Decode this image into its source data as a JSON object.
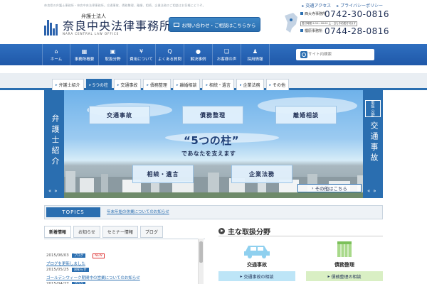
{
  "header": {
    "tagline": "奈良県の弁護士事務所・奈良中央法律事務所。交通事故、債務整理、離婚、相続、企業法務のご相談はお気軽にどうぞ。",
    "links": [
      "交通アクセス",
      "プライバシーポリシー"
    ],
    "logo": {
      "sub": "弁護士法人",
      "main": "奈良中央法律事務所",
      "en": "NARA CENTRAL LAW OFFICE"
    },
    "contact_button": "お問い合わせ・ご相談はこちらから",
    "offices": [
      {
        "name": "西大寺事務所",
        "phone": "0742-30-0816"
      },
      {
        "name": "橿原事務所",
        "phone": "0744-28-0816"
      }
    ],
    "hours": "受付時間 9:00～18:00 土・日も予約受付可ます"
  },
  "nav": {
    "items": [
      {
        "icon": "home-icon",
        "glyph": "⌂",
        "label": "ホーム"
      },
      {
        "icon": "building-icon",
        "glyph": "▦",
        "label": "事務所概要"
      },
      {
        "icon": "briefcase-icon",
        "glyph": "▣",
        "label": "取扱分野"
      },
      {
        "icon": "yen-icon",
        "glyph": "¥",
        "label": "費用について"
      },
      {
        "icon": "faq-icon",
        "glyph": "Q",
        "label": "よくある質問"
      },
      {
        "icon": "pin-icon",
        "glyph": "●",
        "label": "解決事例"
      },
      {
        "icon": "chat-icon",
        "glyph": "❏",
        "label": "お客様の声"
      },
      {
        "icon": "person-icon",
        "glyph": "♟",
        "label": "採用情報"
      }
    ],
    "search_placeholder": "サイト内検索"
  },
  "tabs": [
    {
      "label": "弁護士紹介",
      "active": false
    },
    {
      "label": "5つの柱",
      "active": true
    },
    {
      "label": "交通事故",
      "active": false
    },
    {
      "label": "債務整理",
      "active": false
    },
    {
      "label": "離婚相談",
      "active": false
    },
    {
      "label": "相続・遺言",
      "active": false
    },
    {
      "label": "企業法務",
      "active": false
    },
    {
      "label": "その他",
      "active": false
    }
  ],
  "hero": {
    "left_label": "弁護士紹介",
    "right_small": [
      "取扱",
      "分野"
    ],
    "right_label": "交通事故",
    "arrows": "«»",
    "boxes": [
      "交通事故",
      "債務整理",
      "離婚相談",
      "相続・遺言",
      "企業法務"
    ],
    "title": "“5つの柱”",
    "subtitle": "であなたを支えます",
    "more": "その他はこちら"
  },
  "topics": {
    "label": "TOPICS",
    "text": "年末年始の休業についてのお知らせ"
  },
  "news": {
    "tabs": [
      "新着情報",
      "お知らせ",
      "セミナー情報",
      "ブログ"
    ],
    "items": [
      {
        "date": "2015/06/03",
        "badge": "ブログ",
        "new": "NEW",
        "title": "ブログを更新しました"
      },
      {
        "date": "2015/05/25",
        "badge": "お知らせ",
        "new": "",
        "title": "ゴールデンウィーク期間中の営業についてのお知らせ"
      },
      {
        "date": "2015/04/27",
        "badge": "ブログ",
        "new": "",
        "title": ""
      }
    ]
  },
  "practice": {
    "title": "主な取扱分野",
    "cards": [
      {
        "name": "交通事故",
        "button": "交通事故の相談",
        "color": "#bde5f7"
      },
      {
        "name": "債務整理",
        "button": "債務整理の相談",
        "color": "#d9efc4"
      }
    ]
  }
}
